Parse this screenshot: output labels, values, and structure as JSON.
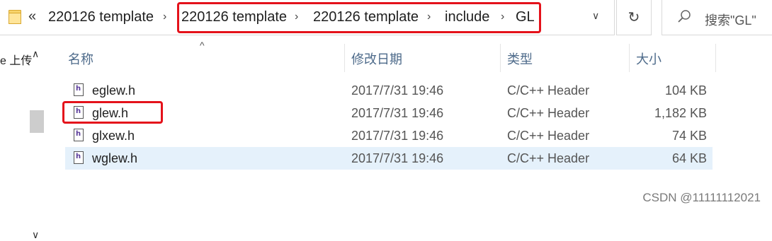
{
  "address_bar": {
    "overflow": "«",
    "crumbs": [
      "220126 template",
      "220126 template",
      "220126 template",
      "include",
      "GL"
    ]
  },
  "search": {
    "placeholder": "搜索\"GL\""
  },
  "nav": {
    "partial_label": "e 上传"
  },
  "columns": {
    "name": "名称",
    "date": "修改日期",
    "type": "类型",
    "size": "大小"
  },
  "files": [
    {
      "name": "eglew.h",
      "date": "2017/7/31 19:46",
      "type": "C/C++ Header",
      "size": "104 KB"
    },
    {
      "name": "glew.h",
      "date": "2017/7/31 19:46",
      "type": "C/C++ Header",
      "size": "1,182 KB"
    },
    {
      "name": "glxew.h",
      "date": "2017/7/31 19:46",
      "type": "C/C++ Header",
      "size": "74 KB"
    },
    {
      "name": "wglew.h",
      "date": "2017/7/31 19:46",
      "type": "C/C++ Header",
      "size": "64 KB"
    }
  ],
  "watermark": "CSDN @11111112021",
  "colors": {
    "highlight": "#e4121b",
    "selected_row": "#e5f1fb",
    "header_text": "#4d6a8a"
  }
}
